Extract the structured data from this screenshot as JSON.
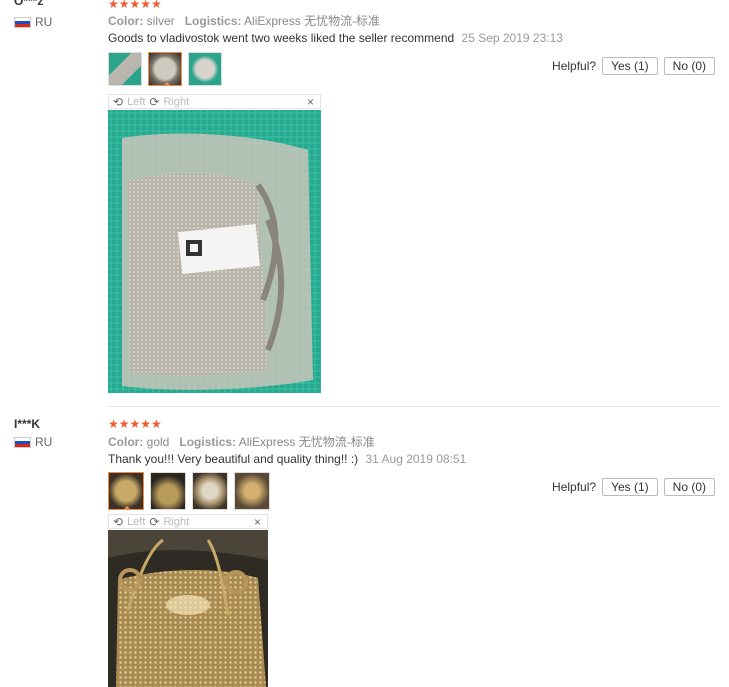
{
  "reviews": [
    {
      "user": "O***z",
      "country": "RU",
      "stars": "★★★★★",
      "color_label": "Color:",
      "color_value": "silver",
      "logistics_label": "Logistics:",
      "logistics_value": "AliExpress 无忧物流-标准",
      "text": "Goods to vladivostok went two weeks liked the seller recommend",
      "date": "25 Sep 2019 23:13",
      "helpful_label": "Helpful?",
      "yes_label": "Yes (1)",
      "no_label": "No (0)",
      "viewer_left": "Left",
      "viewer_right": "Right",
      "close_symbol": "×"
    },
    {
      "user": "I***K",
      "country": "RU",
      "stars": "★★★★★",
      "color_label": "Color:",
      "color_value": "gold",
      "logistics_label": "Logistics:",
      "logistics_value": "AliExpress 无忧物流-标准",
      "text": "Thank you!!! Very beautiful and quality thing!! :)",
      "date": "31 Aug 2019 08:51",
      "helpful_label": "Helpful?",
      "yes_label": "Yes (1)",
      "no_label": "No (0)",
      "viewer_left": "Left",
      "viewer_right": "Right",
      "close_symbol": "×"
    }
  ],
  "colors": {
    "star": "#f05a32",
    "active_border": "#f08b47",
    "photo1_bg": "#2bb39b",
    "photo2_bg": "#3a3226"
  }
}
